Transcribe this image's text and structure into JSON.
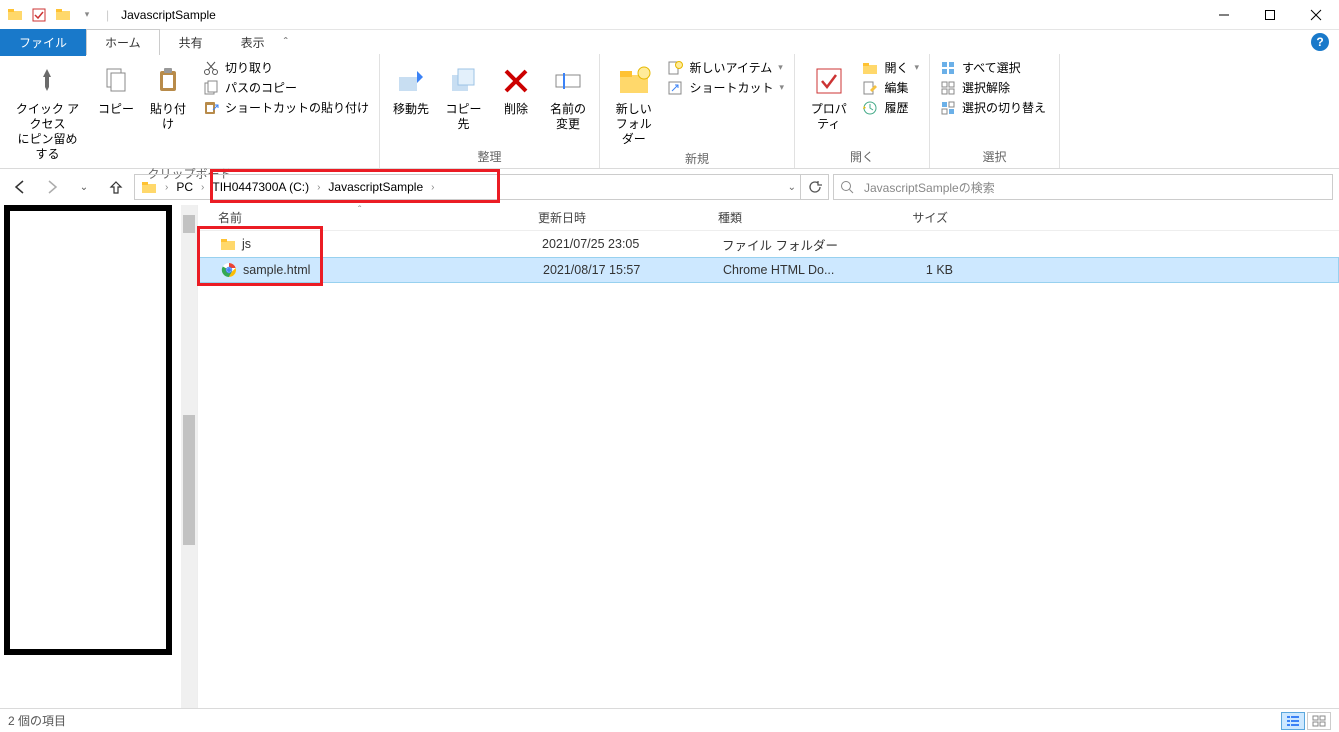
{
  "title_bar": {
    "window_title": "JavascriptSample"
  },
  "tabs": {
    "file": "ファイル",
    "home": "ホーム",
    "share": "共有",
    "view": "表示"
  },
  "ribbon": {
    "clipboard": {
      "pin": "クイック アクセス\nにピン留めする",
      "copy": "コピー",
      "paste": "貼り付け",
      "cut": "切り取り",
      "copy_path": "パスのコピー",
      "paste_shortcut": "ショートカットの貼り付け",
      "label": "クリップボード"
    },
    "organize": {
      "move": "移動先",
      "copy_to": "コピー先",
      "delete": "削除",
      "rename": "名前の\n変更",
      "label": "整理"
    },
    "new": {
      "folder": "新しい\nフォルダー",
      "item": "新しいアイテム",
      "shortcut": "ショートカット",
      "label": "新規"
    },
    "open": {
      "properties": "プロパティ",
      "open": "開く",
      "edit": "編集",
      "history": "履歴",
      "label": "開く"
    },
    "select": {
      "all": "すべて選択",
      "none": "選択解除",
      "invert": "選択の切り替え",
      "label": "選択"
    }
  },
  "address": {
    "crumbs": [
      "PC",
      "TIH0447300A (C:)",
      "JavascriptSample"
    ],
    "search_placeholder": "JavascriptSampleの検索"
  },
  "file_list": {
    "headers": {
      "name": "名前",
      "date": "更新日時",
      "type": "種類",
      "size": "サイズ"
    },
    "rows": [
      {
        "name": "js",
        "date": "2021/07/25 23:05",
        "type": "ファイル フォルダー",
        "size": "",
        "icon": "folder"
      },
      {
        "name": "sample.html",
        "date": "2021/08/17 15:57",
        "type": "Chrome HTML Do...",
        "size": "1 KB",
        "icon": "chrome"
      }
    ]
  },
  "status": {
    "items": "2 個の項目"
  }
}
